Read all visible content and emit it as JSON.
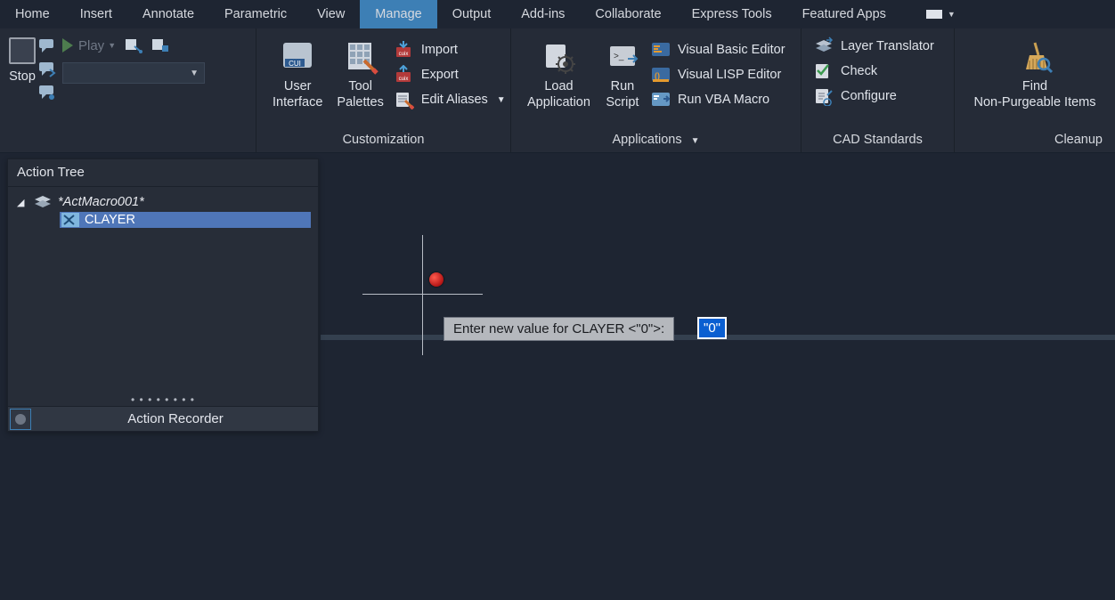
{
  "tabs": {
    "items": [
      "Home",
      "Insert",
      "Annotate",
      "Parametric",
      "View",
      "Manage",
      "Output",
      "Add-ins",
      "Collaborate",
      "Express Tools",
      "Featured Apps"
    ],
    "active_index": 5
  },
  "ribbon": {
    "panel_recorder": {
      "stop_label": "Stop",
      "play_label": "Play"
    },
    "panel_customization": {
      "title": "Customization",
      "user_interface": "User\nInterface",
      "tool_palettes": "Tool\nPalettes",
      "import": "Import",
      "export": "Export",
      "edit_aliases": "Edit Aliases"
    },
    "panel_applications": {
      "title": "Applications",
      "load_application": "Load\nApplication",
      "run_script": "Run\nScript",
      "vbe": "Visual Basic Editor",
      "vle": "Visual LISP Editor",
      "vba": "Run VBA Macro"
    },
    "panel_standards": {
      "title": "CAD Standards",
      "layer_translator": "Layer Translator",
      "check": "Check",
      "configure": "Configure"
    },
    "panel_cleanup": {
      "title": "Cleanup",
      "find": "Find\nNon-Purgeable Items"
    }
  },
  "palette": {
    "title": "Action Tree",
    "root": "*ActMacro001*",
    "child": "CLAYER",
    "footer": "Action Recorder"
  },
  "canvas": {
    "prompt": "Enter new value for CLAYER <\"0\">:",
    "value": "\"0\""
  }
}
